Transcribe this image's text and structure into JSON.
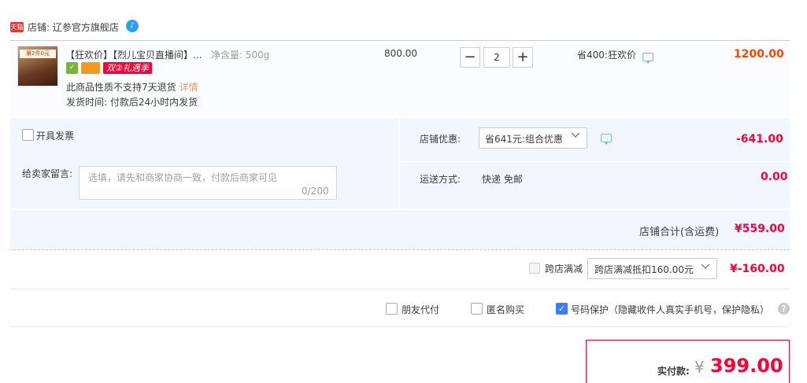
{
  "shop": {
    "badge": "天猫",
    "label": "店铺: 辽参官方旗舰店",
    "ww_icon": "wangwang-chat-icon"
  },
  "item": {
    "thumb_tag": "第2件0元",
    "title": "【狂欢价】【烈儿宝贝直播间】...",
    "spec": "净含量: 500g",
    "promo_badge": "双②礼遇季",
    "no_return": "此商品性质不支持7天退货",
    "no_return_link": "详情",
    "ship_time": "发货时间: 付款后24小时内发货",
    "unit_price": "800.00",
    "quantity": "2",
    "minus": "−",
    "plus": "+",
    "save_text": "省400:狂欢价",
    "total": "1200.00"
  },
  "invoice": {
    "label": "开具发票"
  },
  "remark": {
    "label": "给卖家留言:",
    "placeholder": "选填，请先和商家协商一致，付款后商家可见",
    "count": "0/200"
  },
  "shop_discount": {
    "label": "店铺优惠:",
    "selected": "省641元:组合优惠",
    "amount": "-641.00"
  },
  "shipping": {
    "label": "运送方式:",
    "value": "快递 免邮",
    "amount": "0.00"
  },
  "subtotal": {
    "label": "店铺合计(含运费)",
    "amount": "¥559.00"
  },
  "cross_store": {
    "label": "跨店满减",
    "selected": "跨店满减抵扣160.00元",
    "amount": "¥-160.00"
  },
  "options": {
    "friend_pay": "朋友代付",
    "anonymous": "匿名购买",
    "privacy": "号码保护（隐藏收件人真实手机号，保护隐私）",
    "help": "?"
  },
  "payment": {
    "label": "实付款:",
    "currency": "¥",
    "amount": "399.00"
  },
  "colors": {
    "accent_red": "#ff0036",
    "orange_price": "#ff4400",
    "panel_blue": "#f2f7ff",
    "check_blue": "#3d7eff"
  }
}
